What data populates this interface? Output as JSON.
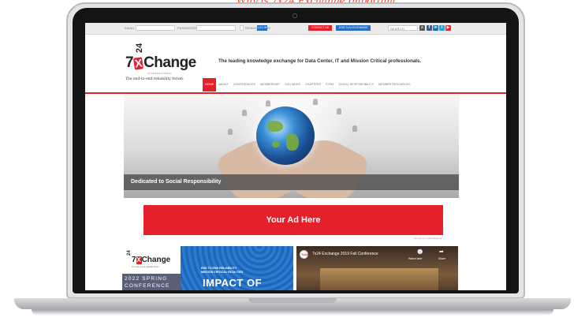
{
  "top_scribble": "Why is 7x24 Exchange Important to Me?",
  "topbar": {
    "email_label": "EMAIL",
    "password_label": "PASSWORD",
    "remember_label": "REMEMBER ME",
    "login_label": "LOG IN",
    "contact_label": "CONTACT US",
    "join_label": "JOIN 7x24 EXCHANGE",
    "search_placeholder": "SEARCH"
  },
  "social": {
    "linkedin": "in",
    "facebook": "f",
    "twitter": "t",
    "youtube": "▶"
  },
  "logo": {
    "mark_prefix": "7",
    "mark_x": "X",
    "mark_suffix": "Change",
    "vertical_24": "24",
    "international": "INTERNATIONAL",
    "tagline": "The end-to-end reliability forum."
  },
  "header_tagline": "The leading knowledge exchange for Data Center, IT and Mission Critical professionals.",
  "nav": [
    "HOME",
    "ABOUT",
    "CONFERENCES",
    "MEMBERSHIP",
    "7x24 NEWS",
    "CHAPTERS",
    "STEM",
    "SOCIAL RESPONSIBILITY",
    "MEMBER RESOURCES"
  ],
  "hero": {
    "caption": "Dedicated to Social Responsibility"
  },
  "ad": {
    "label": "Your Ad Here",
    "small": "Advertise on 7x24exchange.org"
  },
  "promo": {
    "logo_prefix": "7",
    "logo_x": "X",
    "logo_suffix": "Change",
    "vertical_24": "24",
    "subtitle": "The end-to-end reliability forum.",
    "line1": "2022 SPRING",
    "line2": "CONFERENCE",
    "right_line1": "END TO END RELIABILITY",
    "right_line2": "MISSION CRITICAL FACILITIES",
    "impact": "IMPACT OF"
  },
  "video": {
    "avatar": "7x24",
    "title": "7x24 Exchange 2019 Fall Conference",
    "clock": "🕓",
    "watch_later": "Watch later",
    "share_icon": "➦",
    "share": "Share"
  },
  "colors": {
    "brand_red": "#e4202a",
    "topbar_grey": "#ececec"
  }
}
